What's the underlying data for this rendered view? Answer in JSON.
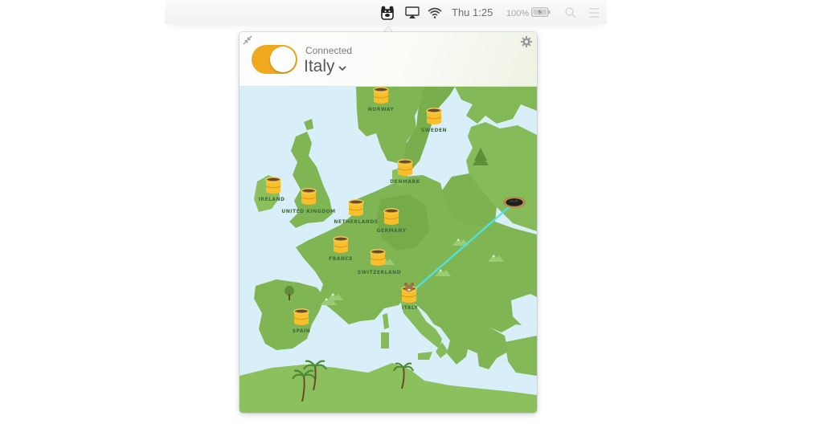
{
  "menubar": {
    "app_icon": "tunnelbear-bear-icon",
    "airplay_icon": "airplay-icon",
    "wifi_icon": "wifi-icon",
    "clock": "Thu 1:25",
    "battery_percent": "100%",
    "battery_icon": "battery-charging-icon",
    "search_icon": "spotlight-search-icon",
    "notification_icon": "notification-center-icon"
  },
  "popover": {
    "status": "Connected",
    "country": "Italy",
    "toggle_on": true,
    "toggle_color": "#f0a81e",
    "settings_icon": "gear-icon",
    "collapse_icon": "collapse-arrows-icon"
  },
  "map": {
    "water_color": "#d8eef8",
    "land_color": "#7fb552",
    "tunnel_color": "#4ee2e6",
    "tunnels": [
      {
        "key": "norway",
        "label": "NORWAY"
      },
      {
        "key": "sweden",
        "label": "SWEDEN"
      },
      {
        "key": "denmark",
        "label": "DENMARK"
      },
      {
        "key": "ireland",
        "label": "IRELAND"
      },
      {
        "key": "uk",
        "label": "UNITED KINGDOM"
      },
      {
        "key": "netherlands",
        "label": "NETHERLANDS"
      },
      {
        "key": "germany",
        "label": "GERMANY"
      },
      {
        "key": "france",
        "label": "FRANCE"
      },
      {
        "key": "switzerland",
        "label": "SWITZERLAND"
      },
      {
        "key": "italy",
        "label": "ITALY",
        "active": true
      },
      {
        "key": "spain",
        "label": "SPAIN"
      }
    ]
  }
}
